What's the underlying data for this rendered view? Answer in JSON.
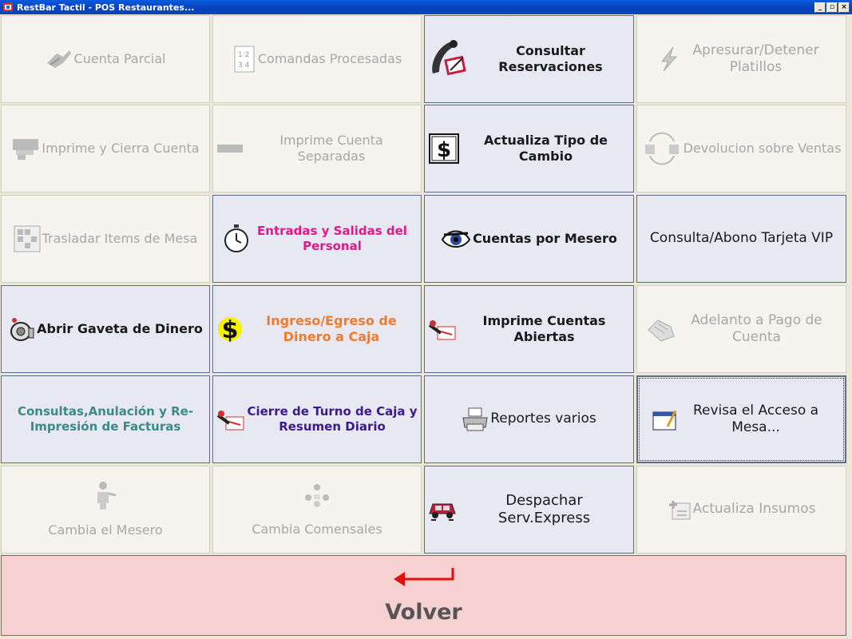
{
  "window": {
    "title": "RestBar Tactil - POS Restaurantes..."
  },
  "buttons": {
    "cuenta_parcial": "Cuenta Parcial",
    "comandas_procesadas": "Comandas Procesadas",
    "consultar_reservaciones": "Consultar Reservaciones",
    "apresurar": "Apresurar/Detener Platillos",
    "imprime_cierra": "Imprime y Cierra Cuenta",
    "imprime_separadas": "Imprime Cuenta Separadas",
    "actualiza_cambio": "Actualiza Tipo de Cambio",
    "devolucion": "Devolucion sobre Ventas",
    "trasladar": "Trasladar Items de Mesa",
    "entradas_salidas": "Entradas y Salidas del Personal",
    "cuentas_mesero": "Cuentas por Mesero",
    "tarjeta_vip": "Consulta/Abono Tarjeta VIP",
    "abrir_gaveta": "Abrir Gaveta de Dinero",
    "ingreso_egreso": "Ingreso/Egreso de Dinero a Caja",
    "imprime_abiertas": "Imprime Cuentas Abiertas",
    "adelanto": "Adelanto a Pago de Cuenta",
    "consultas_facturas": "Consultas,Anulación y Re-Impresión de Facturas",
    "cierre_turno": "Cierre de Turno de Caja y Resumen Diario",
    "reportes": "Reportes varios",
    "revisa_acceso": "Revisa el  Acceso a Mesa...",
    "cambia_mesero": "Cambia el Mesero",
    "cambia_comensales": "Cambia Comensales",
    "despachar": "Despachar Serv.Express",
    "actualiza_insumos": "Actualiza Insumos",
    "volver": "Volver"
  },
  "colors": {
    "disabled_text": "#a7a7a7",
    "active_text": "#1a1a1a",
    "entradas_text": "#e0198a",
    "ingreso_text": "#f07b2a",
    "facturas_text": "#3a8a8a",
    "cierre_text": "#3d1a8a",
    "volver_bg": "#f7d1d1",
    "arrow": "#e01010"
  }
}
